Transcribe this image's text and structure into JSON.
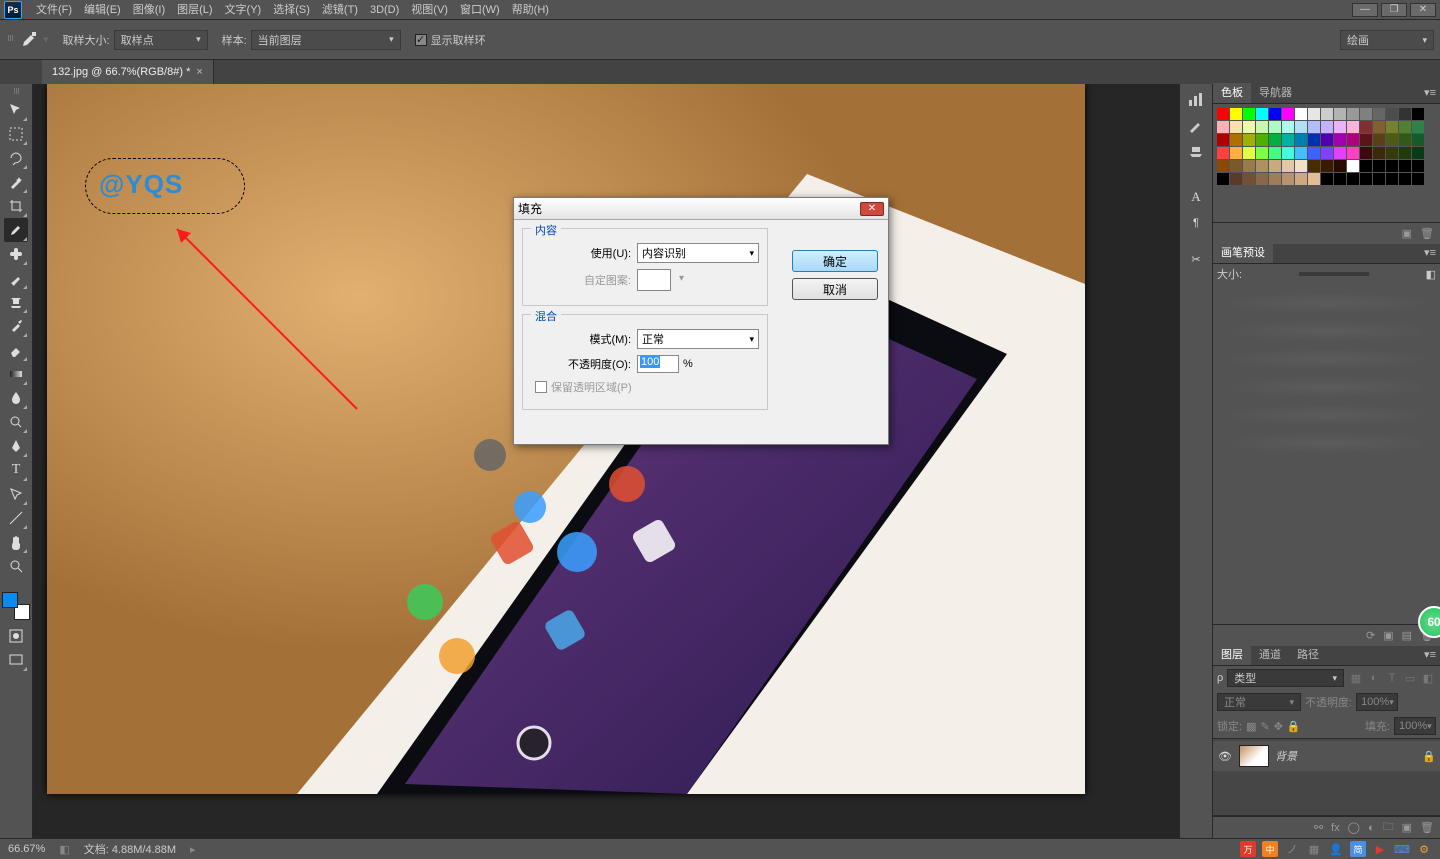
{
  "menu": {
    "items": [
      "文件(F)",
      "编辑(E)",
      "图像(I)",
      "图层(L)",
      "文字(Y)",
      "选择(S)",
      "滤镜(T)",
      "3D(D)",
      "视图(V)",
      "窗口(W)",
      "帮助(H)"
    ]
  },
  "options": {
    "sample_size_label": "取样大小:",
    "sample_size_value": "取样点",
    "sample_label": "样本:",
    "sample_value": "当前图层",
    "show_ring": "显示取样环",
    "right_mode": "绘画"
  },
  "doc_tab": "132.jpg @ 66.7%(RGB/8#) *",
  "watermark": "@YQS",
  "panels": {
    "swatches_tab": "色板",
    "navigator_tab": "导航器",
    "brush_preset_tab": "画笔预设",
    "brush_size_label": "大小:",
    "brush_size_bubble": "60",
    "layers_tab": "图层",
    "channels_tab": "通道",
    "paths_tab": "路径",
    "kind_label": "类型",
    "blend_mode": "正常",
    "opacity_label": "不透明度:",
    "opacity_value": "100%",
    "lock_label": "锁定:",
    "fill_label": "填充:",
    "fill_value": "100%",
    "bg_layer": "背景"
  },
  "status": {
    "zoom": "66.67%",
    "doc_info": "文档: 4.88M/4.88M",
    "ime": "简",
    "ime_badge": "中"
  },
  "dialog": {
    "title": "填充",
    "content_group": "内容",
    "use_label": "使用(U):",
    "use_value": "内容识别",
    "custom_pattern": "自定图案:",
    "blend_group": "混合",
    "mode_label": "模式(M):",
    "mode_value": "正常",
    "opacity_label": "不透明度(O):",
    "opacity_value": "100",
    "percent": "%",
    "preserve_trans": "保留透明区域(P)",
    "ok": "确定",
    "cancel": "取消"
  },
  "swatch_colors": [
    "#ff0000",
    "#ffff00",
    "#00ff00",
    "#00ffff",
    "#0000ff",
    "#ff00ff",
    "#ffffff",
    "#e6e6e6",
    "#cccccc",
    "#b3b3b3",
    "#999999",
    "#808080",
    "#666666",
    "#4d4d4d",
    "#333333",
    "#000000",
    "#f7b2b2",
    "#f7e0b2",
    "#eef7b2",
    "#c9f7b2",
    "#b2f7c6",
    "#b2f7ef",
    "#b2def7",
    "#b2bef7",
    "#c6b2f7",
    "#eab2f7",
    "#f7b2de",
    "#803030",
    "#806030",
    "#788030",
    "#508030",
    "#308048",
    "#b00000",
    "#b07000",
    "#a0b000",
    "#50b000",
    "#00b040",
    "#00b0a0",
    "#0080b0",
    "#0030b0",
    "#5000b0",
    "#a000b0",
    "#b00080",
    "#5a1515",
    "#5a4015",
    "#515a15",
    "#305a15",
    "#155a28",
    "#ff4040",
    "#ffb040",
    "#e0ff40",
    "#80ff40",
    "#40ff80",
    "#40ffe0",
    "#40c0ff",
    "#4060ff",
    "#8040ff",
    "#e040ff",
    "#ff40c0",
    "#3b0a0a",
    "#3b290a",
    "#353b0a",
    "#1e3b0a",
    "#0a3b19",
    "#8a4a00",
    "#7a5a2a",
    "#9a7a4a",
    "#b09060",
    "#c9aa80",
    "#e0c8a8",
    "#f0e0c8",
    "#4a2a00",
    "#3a1a00",
    "#2a0a00",
    "#ffffff",
    "#000000",
    "#000000",
    "#000000",
    "#000000",
    "#000000",
    "#000000",
    "#5a3a2a",
    "#735037",
    "#8a664a",
    "#a07c5c",
    "#b7926f",
    "#cca883",
    "#e2be96",
    "#000000",
    "#000000",
    "#000000",
    "#000000",
    "#000000",
    "#000000",
    "#000000",
    "#000000"
  ]
}
